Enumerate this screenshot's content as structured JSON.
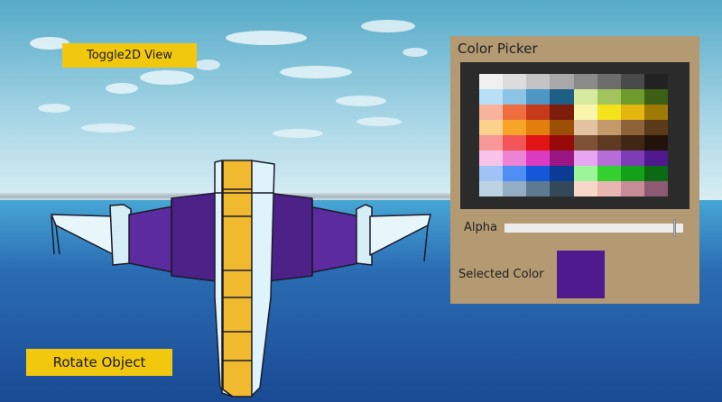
{
  "toolbar": {
    "toggle_label": "Toggle2D View",
    "rotate_label": "Rotate Object"
  },
  "color_picker": {
    "title": "Color Picker",
    "alpha_label": "Alpha",
    "alpha_value": 0.95,
    "selected_label": "Selected Color",
    "selected_color": "#4e1a8e",
    "palette": [
      [
        "#f0f0f0",
        "#dcdcdc",
        "#c4c4c4",
        "#a8a8a8",
        "#8a8a8a",
        "#6c6c6c",
        "#4a4a4a",
        "#222222"
      ],
      [
        "#b9dff6",
        "#8cc4e6",
        "#4e97c4",
        "#1f5f86",
        "#d6eb9f",
        "#a3c45c",
        "#6f9a2c",
        "#3c5f14"
      ],
      [
        "#f7b39c",
        "#ef6e3f",
        "#c6391b",
        "#7c1d0b",
        "#f9f5ab",
        "#f4e21b",
        "#e2b50f",
        "#9e7a05"
      ],
      [
        "#fbd18b",
        "#f7a528",
        "#e17e0c",
        "#9b4e05",
        "#e3c2a1",
        "#c49a6a",
        "#8f6338",
        "#5b3a19"
      ],
      [
        "#f79797",
        "#f25555",
        "#e01414",
        "#970808",
        "#7d5237",
        "#5e3a23",
        "#412614",
        "#22130a"
      ],
      [
        "#f7c3e9",
        "#ee83d4",
        "#db3bc1",
        "#9a1685",
        "#e6a6f2",
        "#b56ed8",
        "#7d3db7",
        "#4e1a8e"
      ],
      [
        "#9fc3f7",
        "#4f8ef2",
        "#1457d8",
        "#0c3b95",
        "#9df59a",
        "#33d02f",
        "#13a11a",
        "#0a6b12"
      ],
      [
        "#bcd3e4",
        "#93aec3",
        "#5d7a90",
        "#33495a",
        "#f8d7c8",
        "#e8b6b0",
        "#c78c96",
        "#8e5972"
      ]
    ]
  },
  "colors": {
    "button_yellow": "#f2c80f",
    "panel_bg": "#b49a73",
    "sky_top": "#62b6cf",
    "sea_mid": "#2d6fb4",
    "wing_purple": "#5a2a9e",
    "hull_white": "#e8f7fb",
    "spine_yellow": "#f0b92e"
  }
}
